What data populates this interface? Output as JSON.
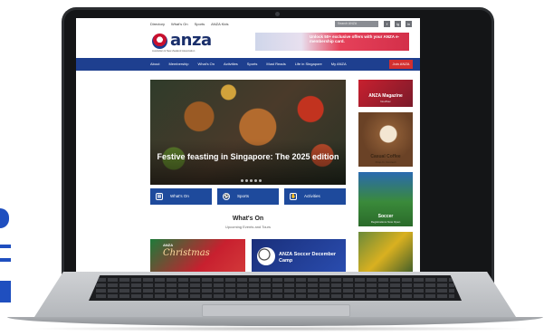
{
  "top_links": [
    "Directory",
    "What's On",
    "Sports",
    "ANZA Kids"
  ],
  "search_placeholder": "Search ANZA",
  "social": [
    "f",
    "ig",
    "in"
  ],
  "logo": {
    "text": "anza",
    "subtitle": "Australian & New Zealand Association"
  },
  "banner_text": "Unlock 50+ exclusive offers with your ANZA e-membership card.",
  "nav": [
    "About",
    "Membership",
    "What's On",
    "Activities",
    "Sports",
    "Must Reads",
    "Life in Singapore",
    "My ANZA"
  ],
  "join_label": "Join ANZA",
  "hero": {
    "title": "Festive feasting in Singapore: The 2025 edition"
  },
  "quick_links": [
    {
      "label": "What's On",
      "icon": "calendar-icon"
    },
    {
      "label": "Sports",
      "icon": "ball-icon"
    },
    {
      "label": "Activities",
      "icon": "hands-icon"
    }
  ],
  "whats_on": {
    "title": "What's On",
    "subtitle": "Upcoming Events and Tours"
  },
  "cards": [
    {
      "badge": "ANZA",
      "title": "Christmas"
    },
    {
      "title": "ANZA Soccer December Camp"
    }
  ],
  "sidebar": [
    {
      "title": "ANZA Magazine",
      "sub": "Nov/Dec"
    },
    {
      "title": "Casual Coffee",
      "sub": "Drop-In, Connect"
    },
    {
      "title": "Soccer",
      "sub": "Registrations Now Open"
    },
    {
      "title": "",
      "sub": ""
    }
  ],
  "colors": {
    "nav_blue": "#1e3f8f",
    "accent_red": "#d32f2f",
    "button_blue": "#1e4a9c"
  }
}
